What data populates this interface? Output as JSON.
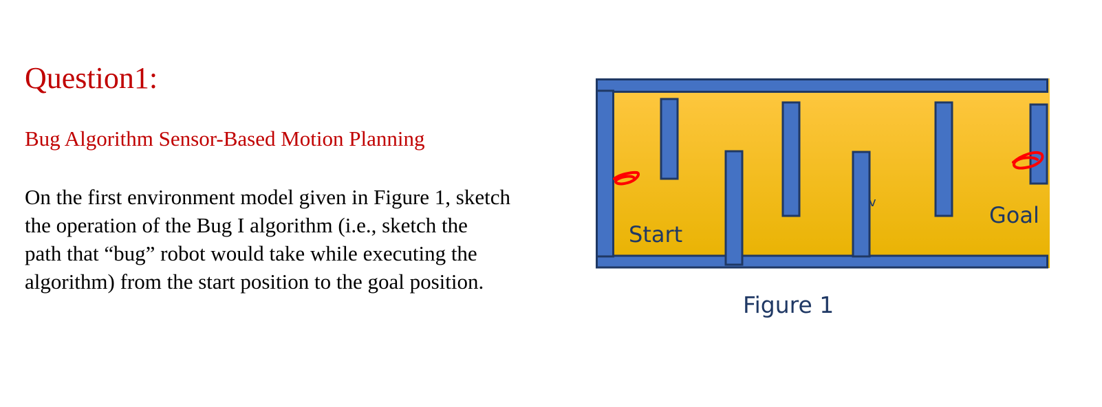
{
  "question": {
    "title": "Question1:",
    "subtitle": "Bug Algorithm Sensor-Based Motion Planning",
    "body_lines": [
      "On the first environment model given in Figure 1, sketch",
      "the operation of the Bug I algorithm (i.e., sketch the",
      "path that “bug” robot would take while executing the",
      "algorithm)  from the start position to the goal position."
    ]
  },
  "figure": {
    "start_label": "Start",
    "goal_label": "Goal",
    "stray_mark": "v",
    "caption": "Figure 1",
    "colors": {
      "background_top": "#ffc843",
      "background_bottom": "#e8b200",
      "wall_fill": "#4472c4",
      "wall_stroke": "#1f3864",
      "marker": "#ff0000",
      "label": "#1f3864"
    }
  }
}
